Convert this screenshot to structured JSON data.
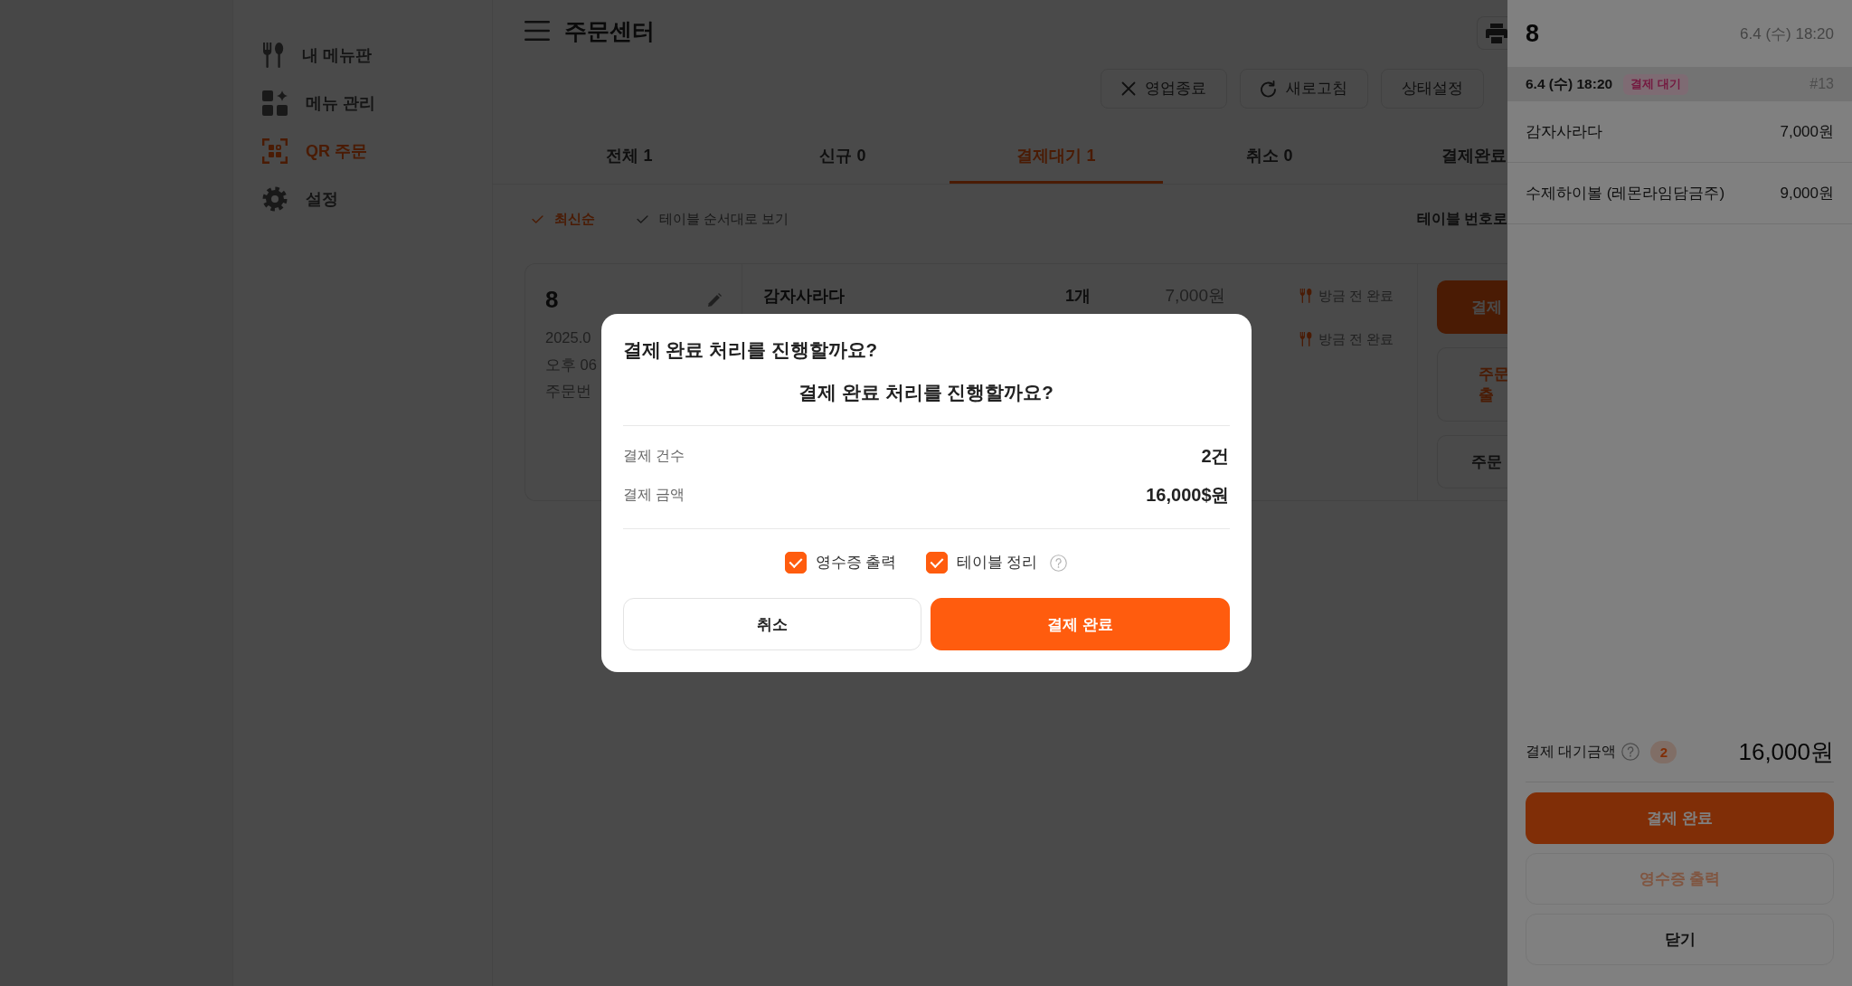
{
  "header": {
    "title": "주문센터"
  },
  "sidebar": {
    "items": [
      {
        "label": "내 메뉴판",
        "selected": false
      },
      {
        "label": "메뉴 관리",
        "selected": false
      },
      {
        "label": "QR 주문",
        "selected": true
      },
      {
        "label": "설정",
        "selected": false
      }
    ]
  },
  "toolbar": {
    "buttons": [
      {
        "label": "영업종료"
      },
      {
        "label": "새로고침"
      },
      {
        "label": "상태설정"
      }
    ]
  },
  "tabs": [
    {
      "label": "전체 1",
      "selected": false
    },
    {
      "label": "신규 0",
      "selected": false
    },
    {
      "label": "결제대기 1",
      "selected": true
    },
    {
      "label": "취소 0",
      "selected": false
    },
    {
      "label": "결제완료",
      "selected": false
    }
  ],
  "filters": {
    "options": [
      {
        "label": "최신순",
        "selected": true
      },
      {
        "label": "테이블 순서대로 보기",
        "selected": false
      }
    ],
    "table_view": "테이블 번호로"
  },
  "order_card": {
    "table": "8",
    "details": [
      "2025.0",
      "오후 06",
      "주문번"
    ],
    "items": [
      {
        "name": "감자사라다",
        "quantity": "1개",
        "price": "7,000원",
        "status": "방금 전 완료"
      },
      {
        "status": "방금 전 완료"
      }
    ],
    "actions": [
      {
        "kind": "primary",
        "lines": [
          "결제"
        ]
      },
      {
        "kind": "accent",
        "lines": [
          "주문",
          "출"
        ]
      },
      {
        "kind": "plain",
        "lines": [
          "주문"
        ]
      }
    ]
  },
  "modal": {
    "title": "결제 완료 처리를 진행할까요?",
    "message": "결제 완료 처리를 진행할까요?",
    "rows": [
      {
        "label": "결제 건수",
        "value": "2건"
      },
      {
        "label": "결제 금액",
        "value": "16,000$원"
      }
    ],
    "options": [
      {
        "label": "영수증 출력",
        "checked": true,
        "help": false
      },
      {
        "label": "테이블 정리",
        "checked": true,
        "help": true
      }
    ],
    "buttons": [
      {
        "label": "취소",
        "kind": "secondary"
      },
      {
        "label": "결제 완료",
        "kind": "primary"
      }
    ]
  },
  "drawer": {
    "table": "8",
    "time": "6.4 (수) 18:20",
    "order": {
      "time": "6.4 (수) 18:20",
      "status": "결제 대기",
      "number": "#13",
      "items": [
        {
          "name": "감자사라다",
          "price": "7,000원"
        },
        {
          "name": "수제하이볼 (레몬라임담금주)",
          "price": "9,000원"
        }
      ]
    },
    "summary": {
      "label": "결제 대기금액",
      "count": "2",
      "total": "16,000원"
    },
    "buttons": [
      {
        "label": "결제 완료",
        "kind": "primary",
        "disabled": false
      },
      {
        "label": "영수증 출력",
        "kind": "accent",
        "disabled": true
      },
      {
        "label": "닫기",
        "kind": "plain",
        "disabled": false
      }
    ]
  }
}
